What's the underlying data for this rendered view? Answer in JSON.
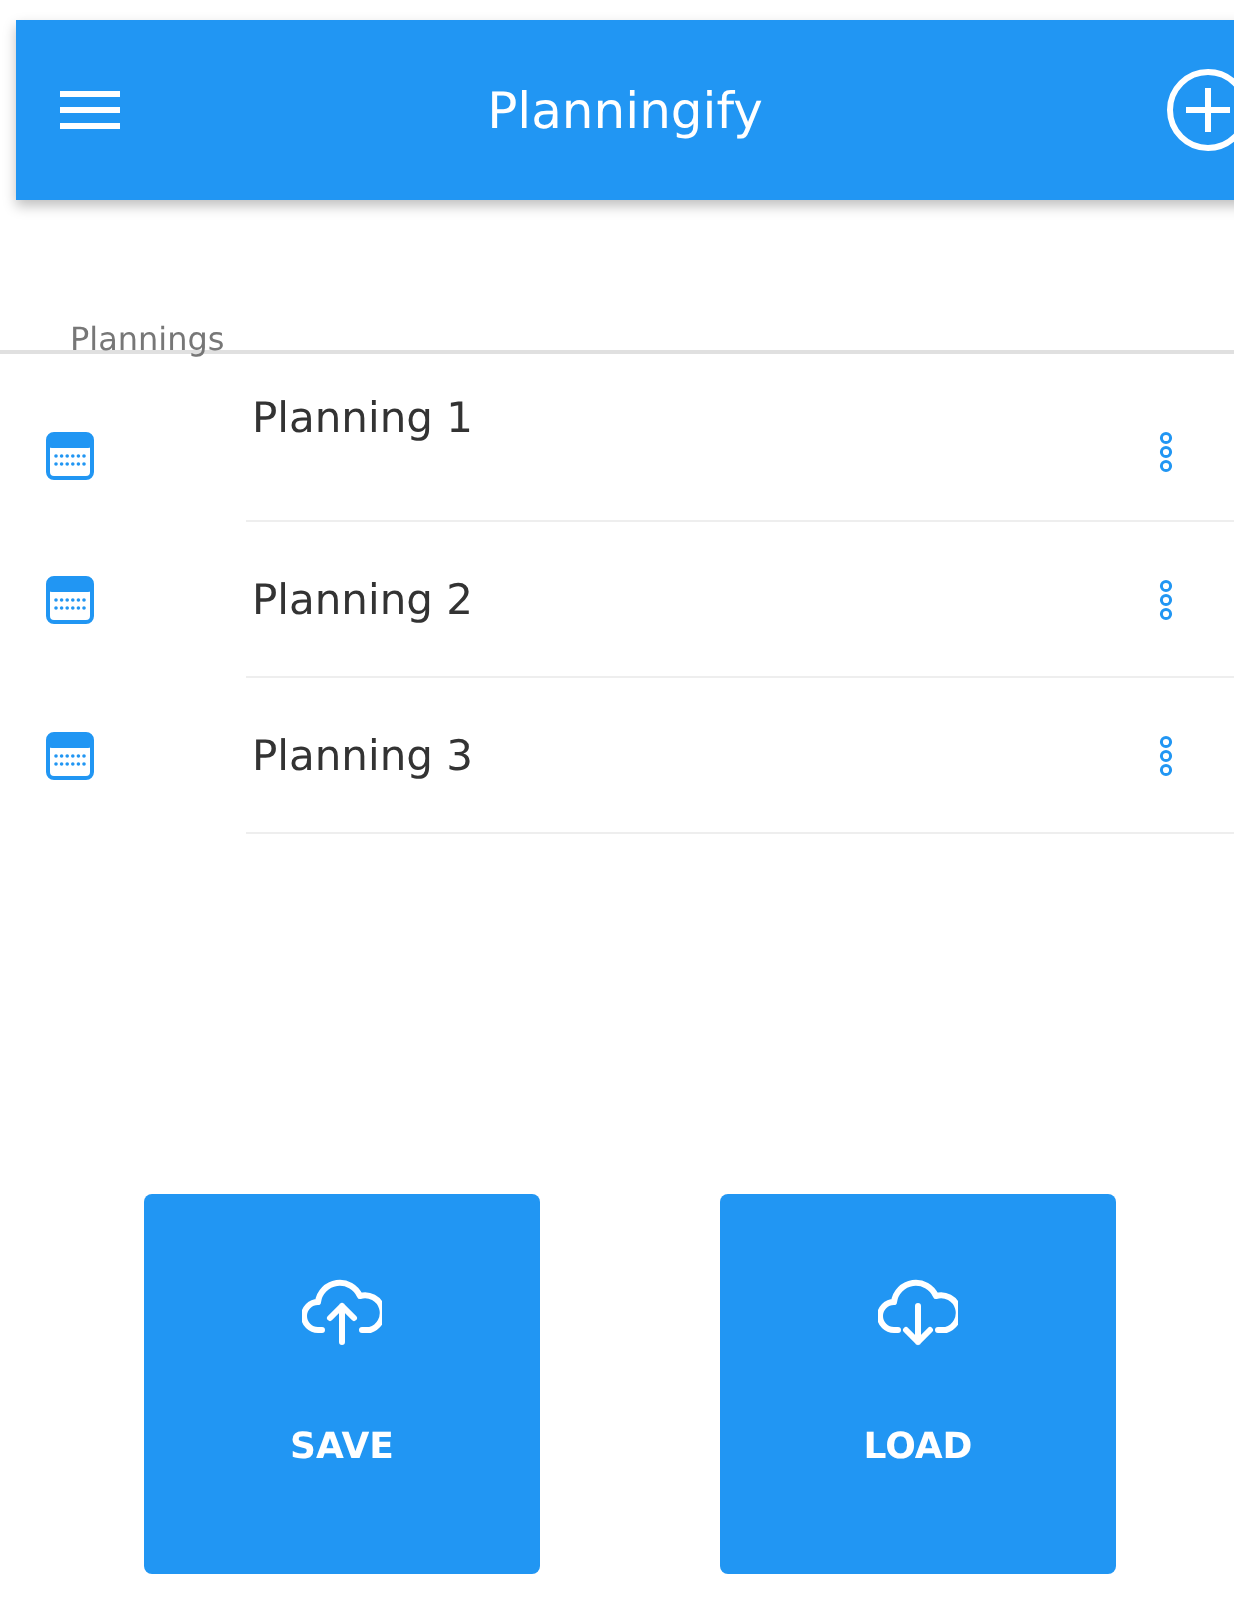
{
  "app_bar": {
    "title": "Planningify"
  },
  "section": {
    "label": "Plannings"
  },
  "plannings": [
    {
      "name": "Planning 1"
    },
    {
      "name": "Planning 2"
    },
    {
      "name": "Planning 3"
    }
  ],
  "actions": [
    {
      "label": "SAVE",
      "kind": "upload"
    },
    {
      "label": "LOAD",
      "kind": "download"
    }
  ]
}
